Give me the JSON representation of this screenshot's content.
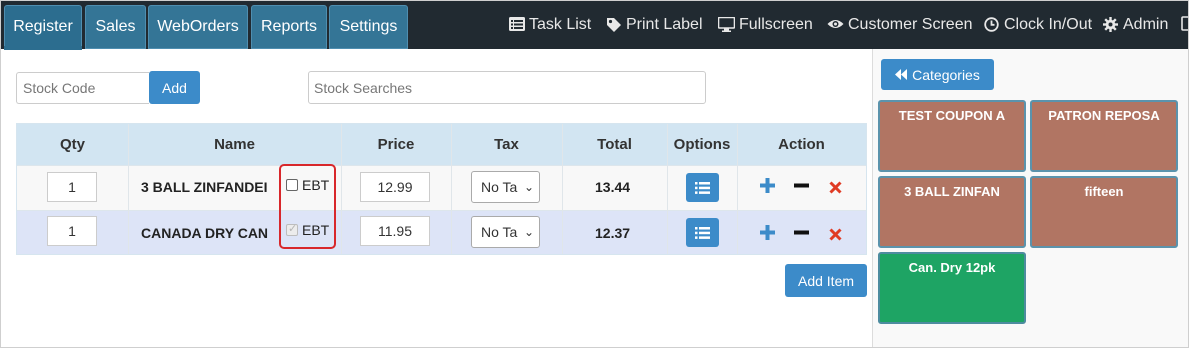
{
  "nav": {
    "tabs": [
      {
        "label": "Register",
        "active": true
      },
      {
        "label": "Sales"
      },
      {
        "label": "WebOrders"
      },
      {
        "label": "Reports"
      },
      {
        "label": "Settings"
      }
    ],
    "links": [
      {
        "label": "Task List",
        "icon": "list-icon"
      },
      {
        "label": "Print Label",
        "icon": "tag-icon"
      },
      {
        "label": "Fullscreen",
        "icon": "monitor-icon"
      },
      {
        "label": "Customer Screen",
        "icon": "eye-icon"
      },
      {
        "label": "Clock In/Out",
        "icon": "clock-icon"
      },
      {
        "label": "Admin",
        "icon": "gear-icon"
      }
    ]
  },
  "stock": {
    "code_placeholder": "Stock Code",
    "add_label": "Add",
    "search_placeholder": "Stock Searches"
  },
  "table": {
    "headers": [
      "Qty",
      "Name",
      "Price",
      "Tax",
      "Total",
      "Options",
      "Action"
    ],
    "rows": [
      {
        "qty": "1",
        "name": "3 BALL ZINFANDEI",
        "ebt_label": "EBT",
        "ebt_checked": false,
        "price": "12.99",
        "tax": "No Ta",
        "total": "13.44"
      },
      {
        "qty": "1",
        "name": "CANADA DRY CAN",
        "ebt_label": "EBT",
        "ebt_checked": true,
        "price": "11.95",
        "tax": "No Ta",
        "total": "12.37"
      }
    ],
    "add_item_label": "Add Item"
  },
  "categories": {
    "back_label": "Categories",
    "tiles": [
      {
        "label": "TEST COUPON A",
        "color": "#b17563"
      },
      {
        "label": "PATRON REPOSA",
        "color": "#b17563"
      },
      {
        "label": "3 BALL ZINFAN",
        "color": "#b17563"
      },
      {
        "label": "fifteen",
        "color": "#b17563"
      },
      {
        "label": "Can. Dry 12pk",
        "color": "#1ea464"
      }
    ]
  },
  "colors": {
    "nav_bg": "#212a31",
    "tab_bg": "#347596",
    "primary": "#3c8bc9",
    "highlight": "#d8272b",
    "remove": "#e03b24"
  }
}
